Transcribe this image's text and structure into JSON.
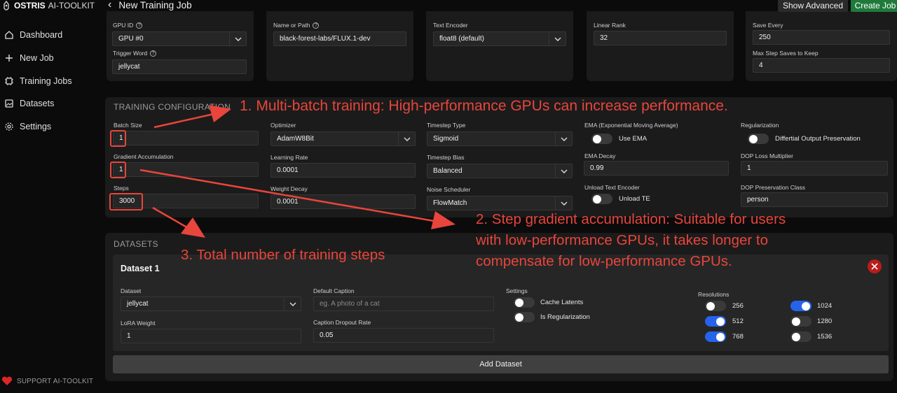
{
  "app": {
    "brand_strong": "OSTRIS",
    "brand_rest": "AI-TOOLKIT",
    "support": "SUPPORT AI-TOOLKIT"
  },
  "sidebar": {
    "items": [
      {
        "label": "Dashboard",
        "icon": "home-icon"
      },
      {
        "label": "New Job",
        "icon": "plus-icon"
      },
      {
        "label": "Training Jobs",
        "icon": "cpu-icon"
      },
      {
        "label": "Datasets",
        "icon": "images-icon"
      },
      {
        "label": "Settings",
        "icon": "gear-icon"
      }
    ]
  },
  "header": {
    "back": "‹",
    "title": "New Training Job",
    "show_advanced": "Show Advanced",
    "create_job": "Create Job"
  },
  "top": {
    "gpu_id_label": "GPU ID",
    "gpu_id": "GPU #0",
    "trigger_label": "Trigger Word",
    "trigger": "jellycat",
    "name_label": "Name or Path",
    "name": "black-forest-labs/FLUX.1-dev",
    "te_label": "Text Encoder",
    "te": "float8 (default)",
    "rank_label": "Linear Rank",
    "rank": "32",
    "save_every_label": "Save Every",
    "save_every": "250",
    "max_saves_label": "Max Step Saves to Keep",
    "max_saves": "4"
  },
  "training": {
    "title": "TRAINING CONFIGURATION",
    "batch_label": "Batch Size",
    "batch": "1",
    "grad_label": "Gradient Accumulation",
    "grad": "1",
    "steps_label": "Steps",
    "steps": "3000",
    "optimizer_label": "Optimizer",
    "optimizer": "AdamW8Bit",
    "lr_label": "Learning Rate",
    "lr": "0.0001",
    "wd_label": "Weight Decay",
    "wd": "0.0001",
    "tstype_label": "Timestep Type",
    "tstype": "Sigmoid",
    "tsbias_label": "Timestep Bias",
    "tsbias": "Balanced",
    "noise_label": "Noise Scheduler",
    "noise": "FlowMatch",
    "ema_label": "EMA (Exponential Moving Average)",
    "use_ema": "Use EMA",
    "ema_decay_label": "EMA Decay",
    "ema_decay": "0.99",
    "unload_label": "Unload Text Encoder",
    "unload_te": "Unload TE",
    "reg_label": "Regularization",
    "dop": "Differtial Output Preservation",
    "dop_mult_label": "DOP Loss Multiplier",
    "dop_mult": "1",
    "dop_class_label": "DOP Preservation Class",
    "dop_class": "person"
  },
  "datasets": {
    "title": "DATASETS",
    "card_title": "Dataset 1",
    "dataset_label": "Dataset",
    "dataset": "jellycat",
    "lora_weight_label": "LoRA Weight",
    "lora_weight": "1",
    "caption_label": "Default Caption",
    "caption_placeholder": "eg. A photo of a cat",
    "dropout_label": "Caption Dropout Rate",
    "dropout": "0.05",
    "settings_label": "Settings",
    "cache_latents": "Cache Latents",
    "is_reg": "Is Regularization",
    "res_label": "Resolutions",
    "resolutions": [
      {
        "v": "256",
        "on": false
      },
      {
        "v": "512",
        "on": true
      },
      {
        "v": "768",
        "on": true
      },
      {
        "v": "1024",
        "on": true
      },
      {
        "v": "1280",
        "on": false
      },
      {
        "v": "1536",
        "on": false
      }
    ],
    "add": "Add Dataset"
  },
  "annotations": {
    "a1": "1. Multi-batch training: High-performance GPUs can increase performance.",
    "a2_l1": "2. Step gradient accumulation: Suitable for users",
    "a2_l2": "with low-performance GPUs, it takes longer to",
    "a2_l3": "compensate for low-performance GPUs.",
    "a3": "3. Total number of training steps",
    "color": "#e8453c"
  }
}
